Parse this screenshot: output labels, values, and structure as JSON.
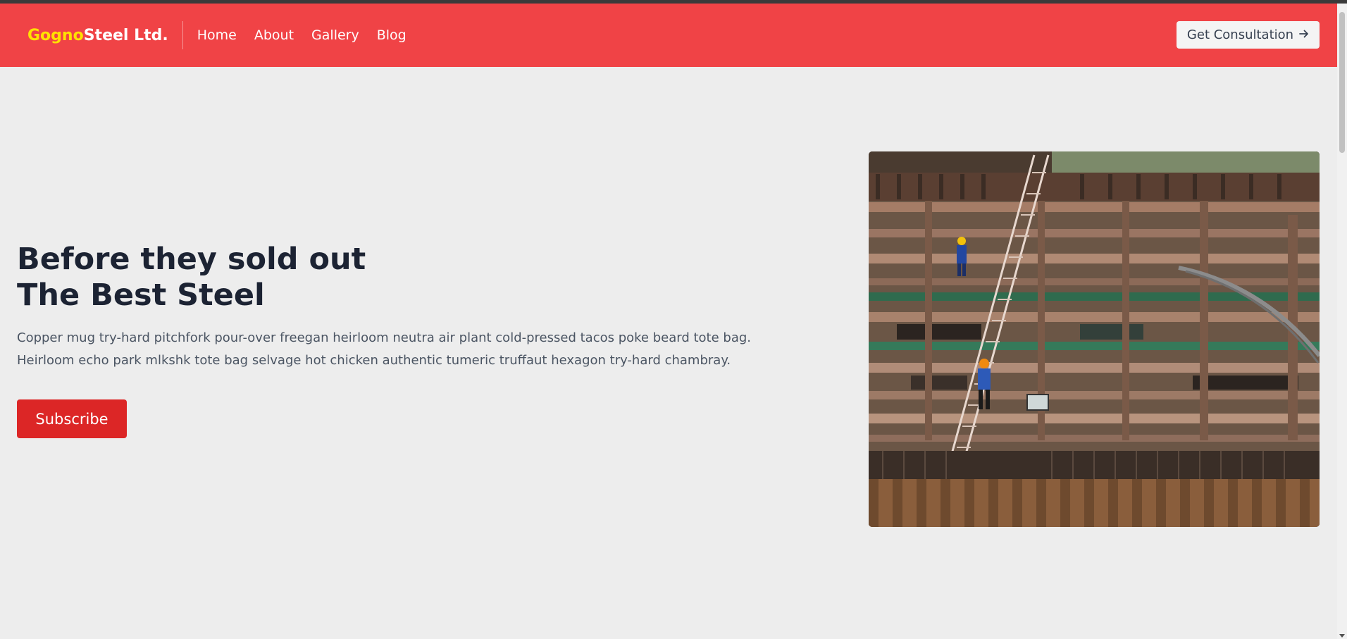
{
  "header": {
    "brand_accent": "Gogno",
    "brand_rest": "Steel Ltd.",
    "nav": [
      "Home",
      "About",
      "Gallery",
      "Blog"
    ],
    "cta_label": "Get Consultation",
    "cta_icon": "arrow-right-icon"
  },
  "hero": {
    "title_line1": "Before they sold out",
    "title_line2": "The Best Steel",
    "desc_line1": "Copper mug try-hard pitchfork pour-over freegan heirloom neutra air plant cold-pressed tacos poke beard tote bag.",
    "desc_line2": "Heirloom echo park mlkshk tote bag selvage hot chicken authentic tumeric truffaut hexagon try-hard chambray.",
    "button_label": "Subscribe"
  },
  "colors": {
    "navbar": "#f04346",
    "brand_accent": "#ffe100",
    "button": "#dc2626",
    "background": "#ededed"
  }
}
